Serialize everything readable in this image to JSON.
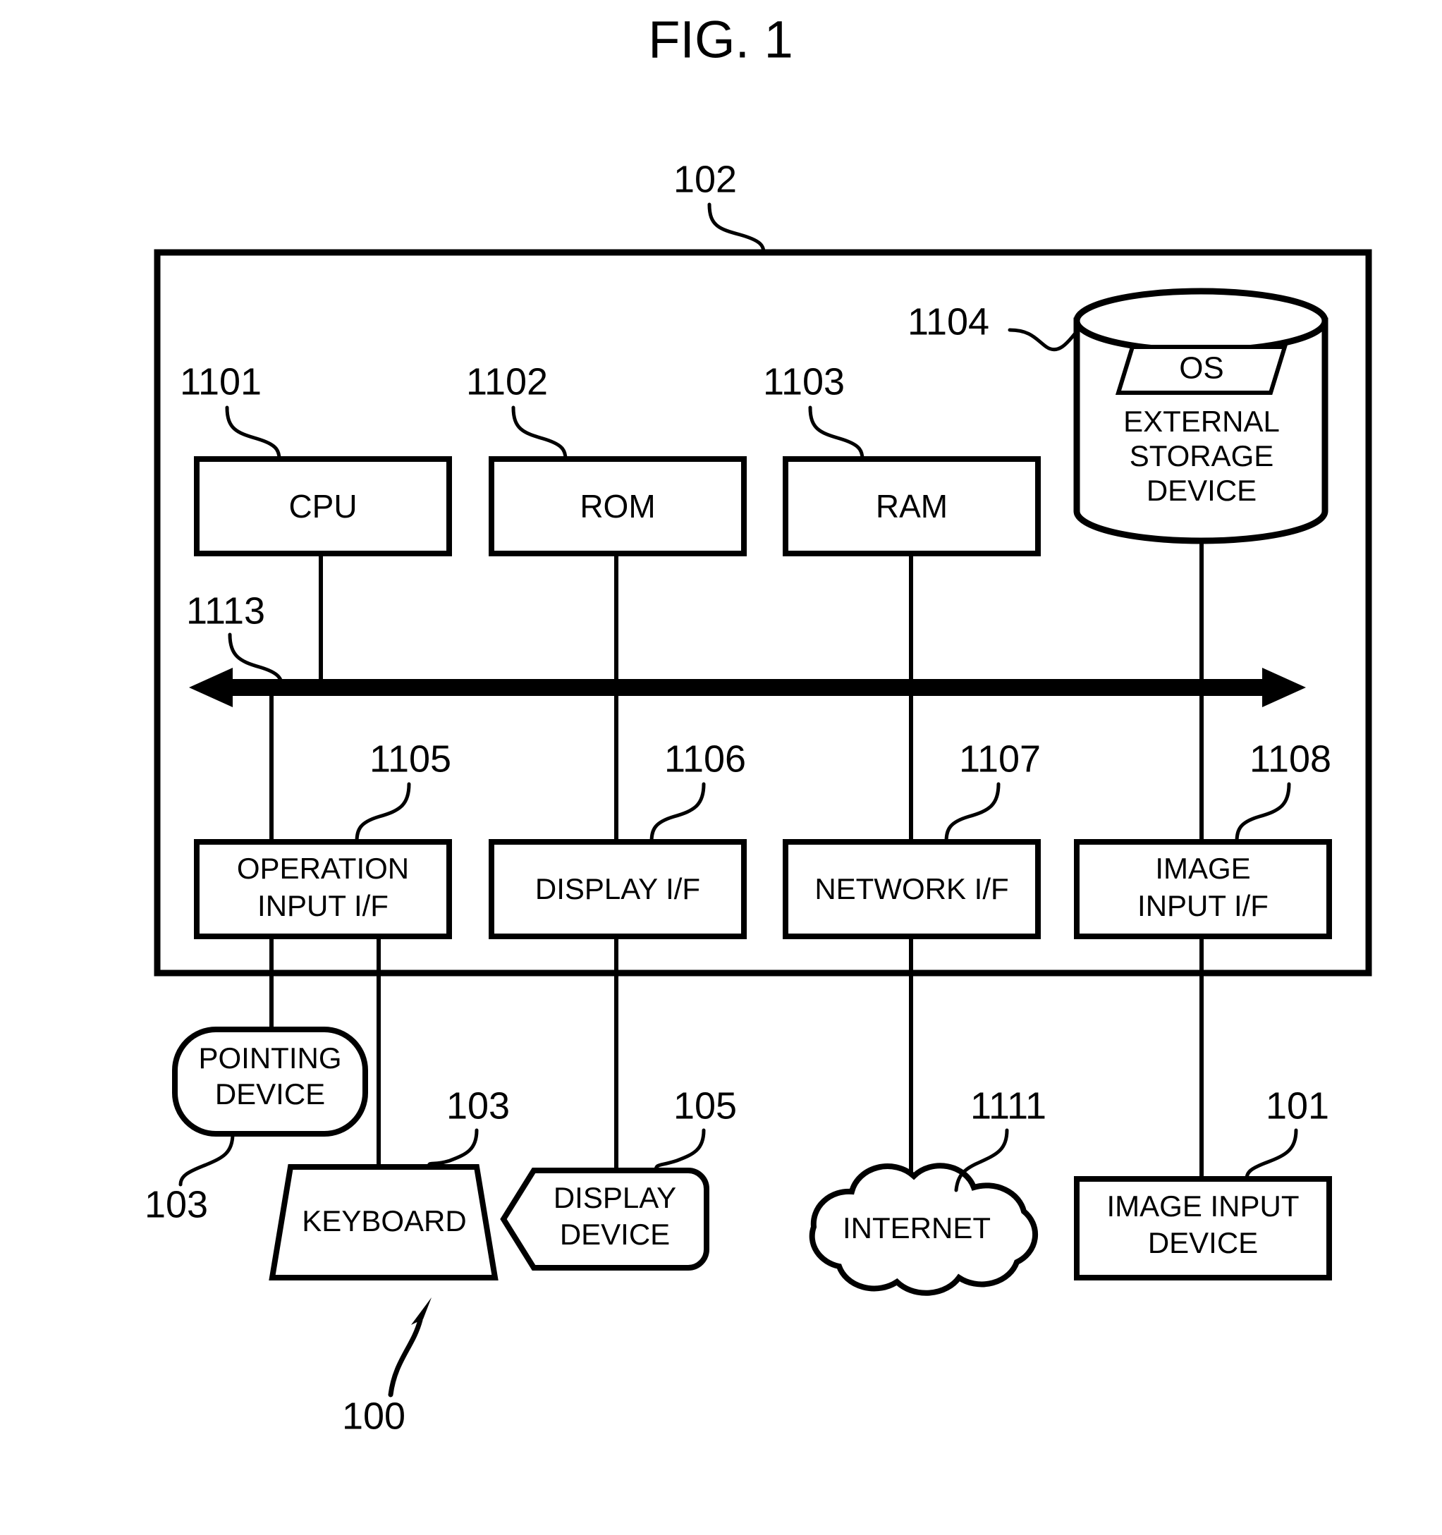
{
  "figure": {
    "title": "FIG. 1",
    "system_ref": "100",
    "computer_ref": "102"
  },
  "core_blocks": [
    {
      "id": "cpu",
      "label": "CPU",
      "ref": "1101"
    },
    {
      "id": "rom",
      "label": "ROM",
      "ref": "1102"
    },
    {
      "id": "ram",
      "label": "RAM",
      "ref": "1103"
    }
  ],
  "storage": {
    "ref": "1104",
    "inner_label": "OS",
    "label_line1": "EXTERNAL",
    "label_line2": "STORAGE",
    "label_line3": "DEVICE"
  },
  "bus": {
    "ref": "1113"
  },
  "interfaces": [
    {
      "id": "operation-input-if",
      "ref": "1105",
      "line1": "OPERATION",
      "line2": "INPUT I/F"
    },
    {
      "id": "display-if",
      "ref": "1106",
      "line1": "DISPLAY I/F",
      "line2": ""
    },
    {
      "id": "network-if",
      "ref": "1107",
      "line1": "NETWORK I/F",
      "line2": ""
    },
    {
      "id": "image-input-if",
      "ref": "1108",
      "line1": "IMAGE",
      "line2": "INPUT I/F"
    }
  ],
  "peripherals": {
    "pointing_device": {
      "ref": "103",
      "line1": "POINTING",
      "line2": "DEVICE"
    },
    "keyboard": {
      "ref": "103",
      "line1": "KEYBOARD",
      "line2": ""
    },
    "display_device": {
      "ref": "105",
      "line1": "DISPLAY",
      "line2": "DEVICE"
    },
    "internet": {
      "ref": "1111",
      "line1": "INTERNET",
      "line2": ""
    },
    "image_input_device": {
      "ref": "101",
      "line1": "IMAGE INPUT",
      "line2": "DEVICE"
    }
  },
  "colors": {
    "ink": "#000000",
    "paper": "#ffffff"
  }
}
